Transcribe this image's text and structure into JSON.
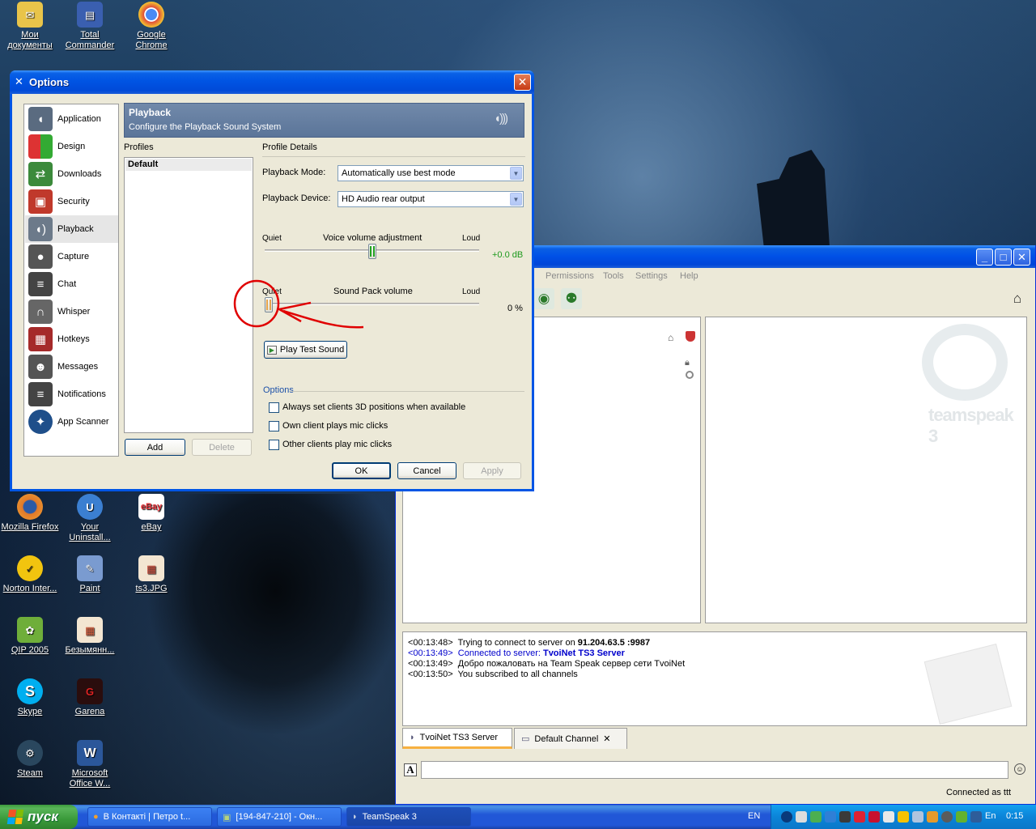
{
  "desktop": {
    "icons": [
      {
        "label": "Мои документы",
        "icon": "folder-documents-icon",
        "color": "#f0c84a"
      },
      {
        "label": "Total Commander",
        "icon": "floppy-disk-icon",
        "color": "#3a5fb0"
      },
      {
        "label": "Google Chrome",
        "icon": "chrome-icon",
        "color": "#d93b2b"
      },
      {
        "label": "Mozilla Firefox",
        "icon": "firefox-icon",
        "color": "#e0792a"
      },
      {
        "label": "Your Uninstall...",
        "icon": "uninstall-icon",
        "color": "#3b7fd1"
      },
      {
        "label": "eBay",
        "icon": "ebay-icon",
        "color": "#e53238"
      },
      {
        "label": "Norton Inter...",
        "icon": "norton-icon",
        "color": "#f1c40f"
      },
      {
        "label": "Paint",
        "icon": "paint-icon",
        "color": "#7a9bd0"
      },
      {
        "label": "ts3.JPG",
        "icon": "image-file-icon",
        "color": "#c94a3a"
      },
      {
        "label": "QIP 2005",
        "icon": "qip-icon",
        "color": "#6fae3a"
      },
      {
        "label": "Безымянн...",
        "icon": "image-file-icon",
        "color": "#d45a3a"
      },
      {
        "label": "Skype",
        "icon": "skype-icon",
        "color": "#00aff0"
      },
      {
        "label": "Garena",
        "icon": "garena-icon",
        "color": "#b21f1f"
      },
      {
        "label": "Steam",
        "icon": "steam-icon",
        "color": "#2a475e"
      },
      {
        "label": "Microsoft Office W...",
        "icon": "word-icon",
        "color": "#2b579a"
      }
    ]
  },
  "teamspeak": {
    "menu": [
      "Permissions",
      "Tools",
      "Settings",
      "Help"
    ],
    "window_buttons": {
      "minimize": "_",
      "maximize": "□",
      "close": "✕"
    },
    "log": [
      {
        "time": "<00:13:48>",
        "text": "Trying to connect to server on ",
        "bold": "91.204.63.5 :9987",
        "color": "#000000"
      },
      {
        "time": "<00:13:49>",
        "text": "Connected to server: ",
        "bold": "TvoiNet TS3 Server",
        "color": "#0000cc"
      },
      {
        "time": "<00:13:49>",
        "text": "Добро пожаловать на Team Speak сервер сети TvoiNet",
        "bold": "",
        "color": "#000000"
      },
      {
        "time": "<00:13:50>",
        "text": "You subscribed to all channels",
        "bold": "",
        "color": "#000000"
      }
    ],
    "tabs": [
      {
        "label": "TvoiNet TS3 Server",
        "icon": "server-icon"
      },
      {
        "label": "Default Channel",
        "icon": "chat-bubble-icon",
        "close": "✕"
      }
    ],
    "chat_input": {
      "value": "",
      "format_button": "A"
    },
    "status": "Connected as ttt",
    "watermark": "teamspeak 3"
  },
  "options_dialog": {
    "title": "Options",
    "close": "✕",
    "nav": [
      {
        "label": "Application",
        "icon": "application-speaker-icon",
        "color": "#5a6b80"
      },
      {
        "label": "Design",
        "icon": "design-palette-icon",
        "color": "#3a7a3a"
      },
      {
        "label": "Downloads",
        "icon": "downloads-arrows-icon",
        "color": "#3b8a3b"
      },
      {
        "label": "Security",
        "icon": "security-lock-icon",
        "color": "#c0392b"
      },
      {
        "label": "Playback",
        "icon": "playback-speaker-icon",
        "color": "#6c7a8a"
      },
      {
        "label": "Capture",
        "icon": "capture-microphone-icon",
        "color": "#555555"
      },
      {
        "label": "Chat",
        "icon": "chat-bubble-icon",
        "color": "#444444"
      },
      {
        "label": "Whisper",
        "icon": "whisper-headset-icon",
        "color": "#666666"
      },
      {
        "label": "Hotkeys",
        "icon": "hotkeys-keyboard-icon",
        "color": "#a52a2a"
      },
      {
        "label": "Messages",
        "icon": "messages-person-icon",
        "color": "#555555"
      },
      {
        "label": "Notifications",
        "icon": "notifications-bubble-icon",
        "color": "#444444"
      },
      {
        "label": "App Scanner",
        "icon": "app-scanner-globe-icon",
        "color": "#1f4f8a"
      }
    ],
    "selected_nav": "Playback",
    "header": {
      "title": "Playback",
      "subtitle": "Configure the Playback Sound System"
    },
    "profiles": {
      "heading": "Profiles",
      "items": [
        "Default"
      ],
      "add": "Add",
      "delete": "Delete"
    },
    "details": {
      "heading": "Profile Details",
      "mode_label": "Playback Mode:",
      "mode_value": "Automatically use best mode",
      "device_label": "Playback Device:",
      "device_value": "HD Audio rear output",
      "voice_slider": {
        "left": "Quiet",
        "title": "Voice volume adjustment",
        "right": "Loud",
        "value_text": "+0.0 dB",
        "position": 0.5
      },
      "sound_pack_slider": {
        "left": "Quiet",
        "title": "Sound Pack volume",
        "right": "Loud",
        "value_text": "0 %",
        "position": 0.0
      },
      "play_test": "Play Test Sound"
    },
    "options": {
      "heading": "Options",
      "checkboxes": [
        {
          "label": "Always set clients 3D positions when available",
          "checked": false
        },
        {
          "label": "Own client plays mic clicks",
          "checked": false
        },
        {
          "label": "Other clients play mic clicks",
          "checked": false
        }
      ]
    },
    "buttons": {
      "ok": "OK",
      "cancel": "Cancel",
      "apply": "Apply"
    }
  },
  "taskbar": {
    "start": "пуск",
    "tasks": [
      {
        "label": "В Контакті | Петро t...",
        "icon": "firefox-icon",
        "active": false
      },
      {
        "label": "[194-847-210] - Окн...",
        "icon": "window-icon",
        "active": false
      },
      {
        "label": "TeamSpeak 3",
        "icon": "teamspeak-icon",
        "active": true
      }
    ],
    "language": "EN",
    "tray_lang": "En",
    "clock": "0:15"
  },
  "colors": {
    "xp_title_blue": "#0054e3",
    "annotation_red": "#e00000",
    "db_value_green": "#1e9a1e"
  }
}
